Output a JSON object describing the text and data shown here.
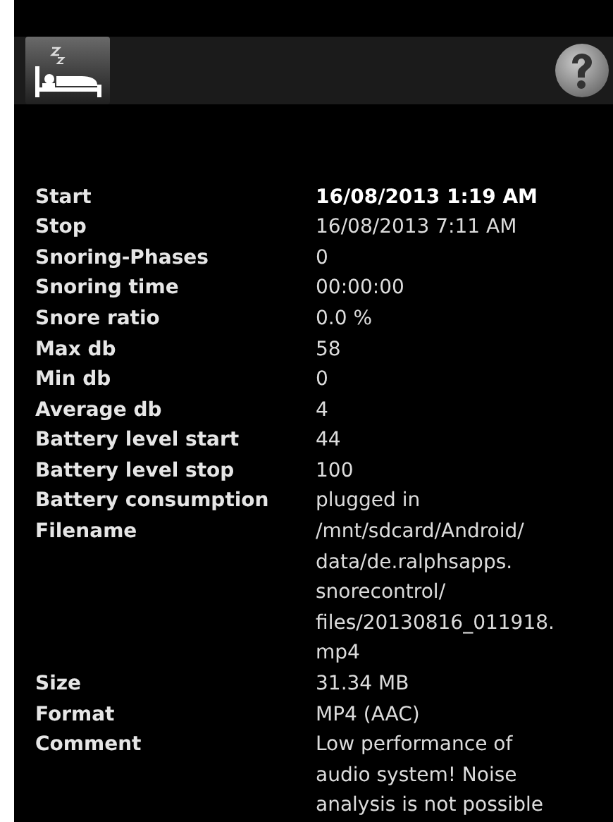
{
  "details": [
    {
      "label": "Start",
      "lines": [
        "16/08/2013 1:19 AM"
      ],
      "emphasized": true
    },
    {
      "label": "Stop",
      "lines": [
        "16/08/2013 7:11 AM"
      ],
      "emphasized": false
    },
    {
      "label": "Snoring-Phases",
      "lines": [
        "0"
      ],
      "emphasized": false
    },
    {
      "label": "Snoring time",
      "lines": [
        "00:00:00"
      ],
      "emphasized": false
    },
    {
      "label": "Snore ratio",
      "lines": [
        "0.0 %"
      ],
      "emphasized": false
    },
    {
      "label": "Max db",
      "lines": [
        "58"
      ],
      "emphasized": false
    },
    {
      "label": "Min db",
      "lines": [
        "0"
      ],
      "emphasized": false
    },
    {
      "label": "Average db",
      "lines": [
        "4"
      ],
      "emphasized": false
    },
    {
      "label": "Battery level start",
      "lines": [
        "44"
      ],
      "emphasized": false
    },
    {
      "label": "Battery level stop",
      "lines": [
        "100"
      ],
      "emphasized": false
    },
    {
      "label": "Battery consumption",
      "lines": [
        "plugged in"
      ],
      "emphasized": false
    },
    {
      "label": "Filename",
      "lines": [
        "/mnt/sdcard/Android/",
        "data/de.ralphsapps.",
        "snorecontrol/",
        "files/20130816_011918.",
        "mp4"
      ],
      "emphasized": false
    },
    {
      "label": "Size",
      "lines": [
        "31.34 MB"
      ],
      "emphasized": false
    },
    {
      "label": "Format",
      "lines": [
        "MP4 (AAC)"
      ],
      "emphasized": false
    },
    {
      "label": "Comment",
      "lines": [
        "Low performance of",
        "audio system! Noise",
        "analysis is not possible"
      ],
      "emphasized": false
    }
  ]
}
